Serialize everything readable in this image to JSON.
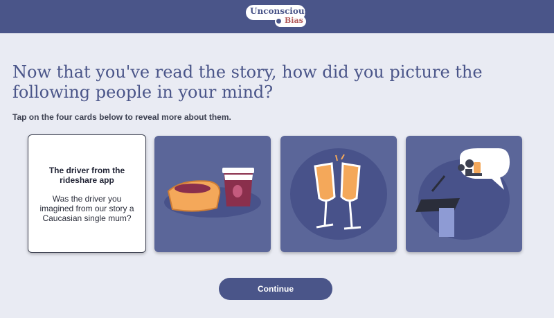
{
  "header": {
    "logo_line1": "Unconscious",
    "logo_line2": "Bias"
  },
  "main": {
    "heading": "Now that you've read the story, how did you picture the following people in your mind?",
    "instruction": "Tap on the four cards below to reveal more about them."
  },
  "cards": [
    {
      "state": "revealed",
      "title": "The driver from the rideshare app",
      "text": "Was the driver you imagined from our story a Caucasian single mum?"
    },
    {
      "state": "hidden",
      "icon": "pie-and-coffee-icon"
    },
    {
      "state": "hidden",
      "icon": "champagne-toast-icon"
    },
    {
      "state": "hidden",
      "icon": "podium-speech-icon"
    }
  ],
  "footer": {
    "continue_label": "Continue"
  },
  "colors": {
    "brand": "#4a5589",
    "card": "#5b6699",
    "background": "#e9ebf3",
    "accent": "#f4a85a",
    "logo_accent": "#b35a5a"
  }
}
